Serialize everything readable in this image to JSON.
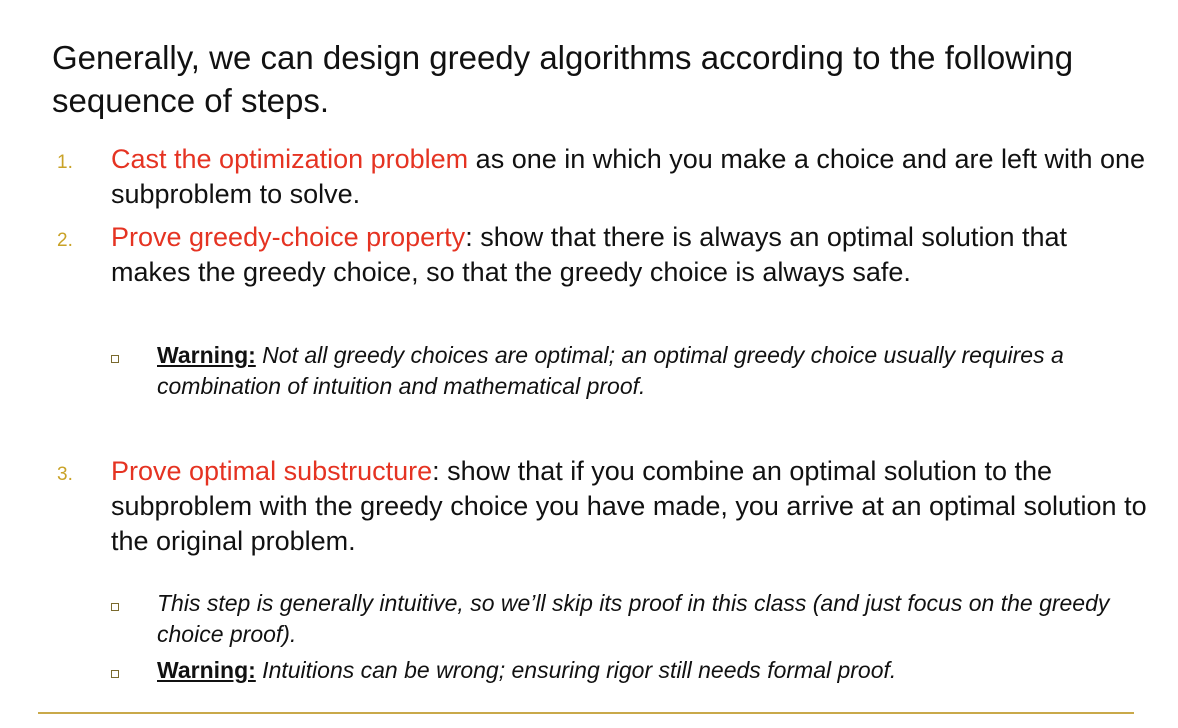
{
  "intro": "Generally, we can design greedy algorithms according to the following sequence of steps.",
  "steps": [
    {
      "number": "1.",
      "highlight": "Cast the optimization problem",
      "rest": " as one in which you make a choice and are left with one subproblem to solve."
    },
    {
      "number": "2.",
      "highlight": "Prove greedy-choice property",
      "rest": ": show that there is always an optimal solution that makes the greedy choice, so that the greedy choice is always safe.",
      "notes": [
        {
          "label": "Warning:",
          "text": " Not all greedy choices are optimal; an optimal greedy choice usually requires a combination of intuition and mathematical proof."
        }
      ]
    },
    {
      "number": "3.",
      "highlight": "Prove optimal substructure",
      "rest": ": show that if you combine an optimal solution to the subproblem with the greedy choice you have made, you arrive at an optimal solution to the original problem.",
      "notes": [
        {
          "label": "",
          "text": "This step is generally intuitive, so we’ll skip its proof in this class (and just focus on the greedy choice proof)."
        },
        {
          "label": "Warning:",
          "text": " Intuitions can be wrong; ensuring rigor still needs formal proof."
        }
      ]
    }
  ],
  "colors": {
    "highlight": "#e53322",
    "number": "#c9a227",
    "rule": "#c9a94a",
    "text": "#111111"
  }
}
